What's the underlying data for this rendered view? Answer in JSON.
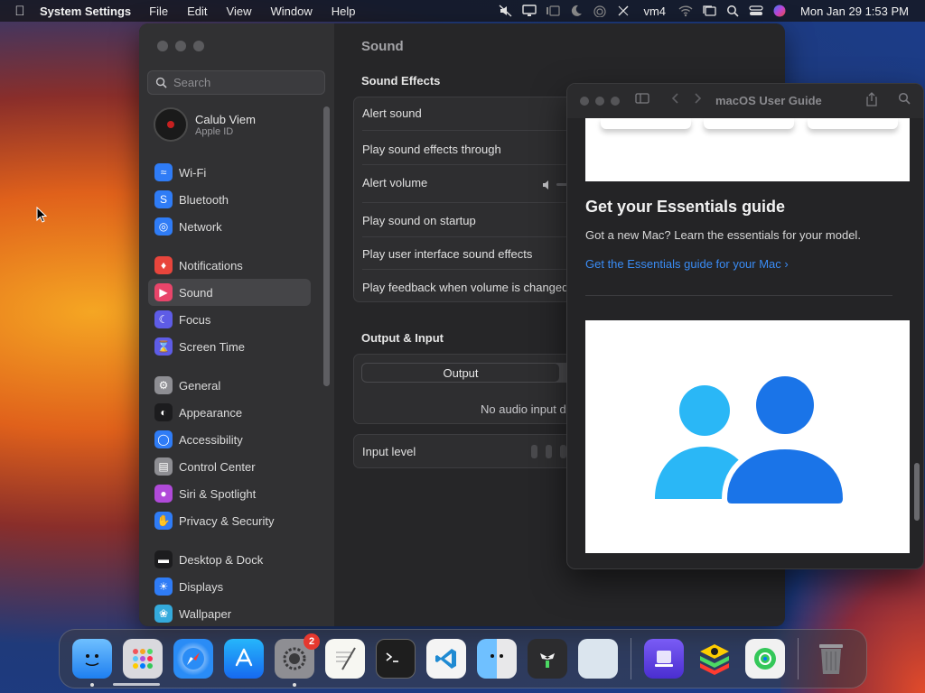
{
  "menubar": {
    "app_name": "System Settings",
    "menus": [
      "File",
      "Edit",
      "View",
      "Window",
      "Help"
    ],
    "status_text": "vm4",
    "clock": "Mon Jan 29  1:53 PM"
  },
  "settings": {
    "search_placeholder": "Search",
    "account": {
      "name": "Calub Viem",
      "sub": "Apple ID"
    },
    "nav_groups": [
      [
        {
          "label": "Wi-Fi",
          "icon": "wifi-icon",
          "color": "#2f7cf6"
        },
        {
          "label": "Bluetooth",
          "icon": "bluetooth-icon",
          "color": "#2f7cf6"
        },
        {
          "label": "Network",
          "icon": "globe-icon",
          "color": "#2f7cf6"
        }
      ],
      [
        {
          "label": "Notifications",
          "icon": "bell-icon",
          "color": "#e8453c"
        },
        {
          "label": "Sound",
          "icon": "speaker-icon",
          "color": "#e8456a",
          "active": true
        },
        {
          "label": "Focus",
          "icon": "moon-icon",
          "color": "#5e5ce6"
        },
        {
          "label": "Screen Time",
          "icon": "hourglass-icon",
          "color": "#5e5ce6"
        }
      ],
      [
        {
          "label": "General",
          "icon": "gear-icon",
          "color": "#8e8e93"
        },
        {
          "label": "Appearance",
          "icon": "appearance-icon",
          "color": "#1c1c1e"
        },
        {
          "label": "Accessibility",
          "icon": "accessibility-icon",
          "color": "#2f7cf6"
        },
        {
          "label": "Control Center",
          "icon": "control-center-icon",
          "color": "#8e8e93"
        },
        {
          "label": "Siri & Spotlight",
          "icon": "siri-icon",
          "color": "#b04ad9"
        },
        {
          "label": "Privacy & Security",
          "icon": "hand-icon",
          "color": "#2f7cf6"
        }
      ],
      [
        {
          "label": "Desktop & Dock",
          "icon": "dock-icon",
          "color": "#1c1c1e"
        },
        {
          "label": "Displays",
          "icon": "display-icon",
          "color": "#2f7cf6"
        },
        {
          "label": "Wallpaper",
          "icon": "wallpaper-icon",
          "color": "#34aadc"
        }
      ]
    ],
    "content_title": "Sound",
    "sound_effects": {
      "title": "Sound Effects",
      "rows": [
        "Alert sound",
        "Play sound effects through",
        "Alert volume",
        "Play sound on startup",
        "Play user interface sound effects",
        "Play feedback when volume is changed"
      ]
    },
    "output_input": {
      "title": "Output & Input",
      "tab_output": "Output",
      "no_input": "No audio input devices found",
      "input_level": "Input level"
    }
  },
  "guide": {
    "title": "macOS User Guide",
    "heading": "Get your Essentials guide",
    "text": "Got a new Mac? Learn the essentials for your model.",
    "link": "Get the Essentials guide for your Mac"
  },
  "dock": {
    "settings_badge": "2"
  }
}
